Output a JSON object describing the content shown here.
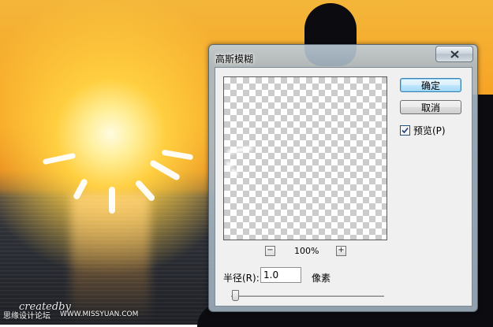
{
  "background": {
    "watermark_cn": "思缘设计论坛",
    "watermark_script": "createdby",
    "watermark_url": "WWW.MISSYUAN.COM"
  },
  "dialog": {
    "title": "高斯模糊",
    "close_icon": "close-x-icon",
    "ok_label": "确定",
    "cancel_label": "取消",
    "preview": {
      "label": "预览(P)",
      "checked": true
    },
    "zoom": {
      "minus_label": "−",
      "level": "100%",
      "plus_label": "+"
    },
    "radius": {
      "label": "半径(R):",
      "value": "1.0",
      "unit": "像素",
      "slider_fraction": 0.01
    }
  },
  "colors": {
    "default_button_border": "#3c7fb1",
    "dialog_frame": "#aab9c6"
  }
}
